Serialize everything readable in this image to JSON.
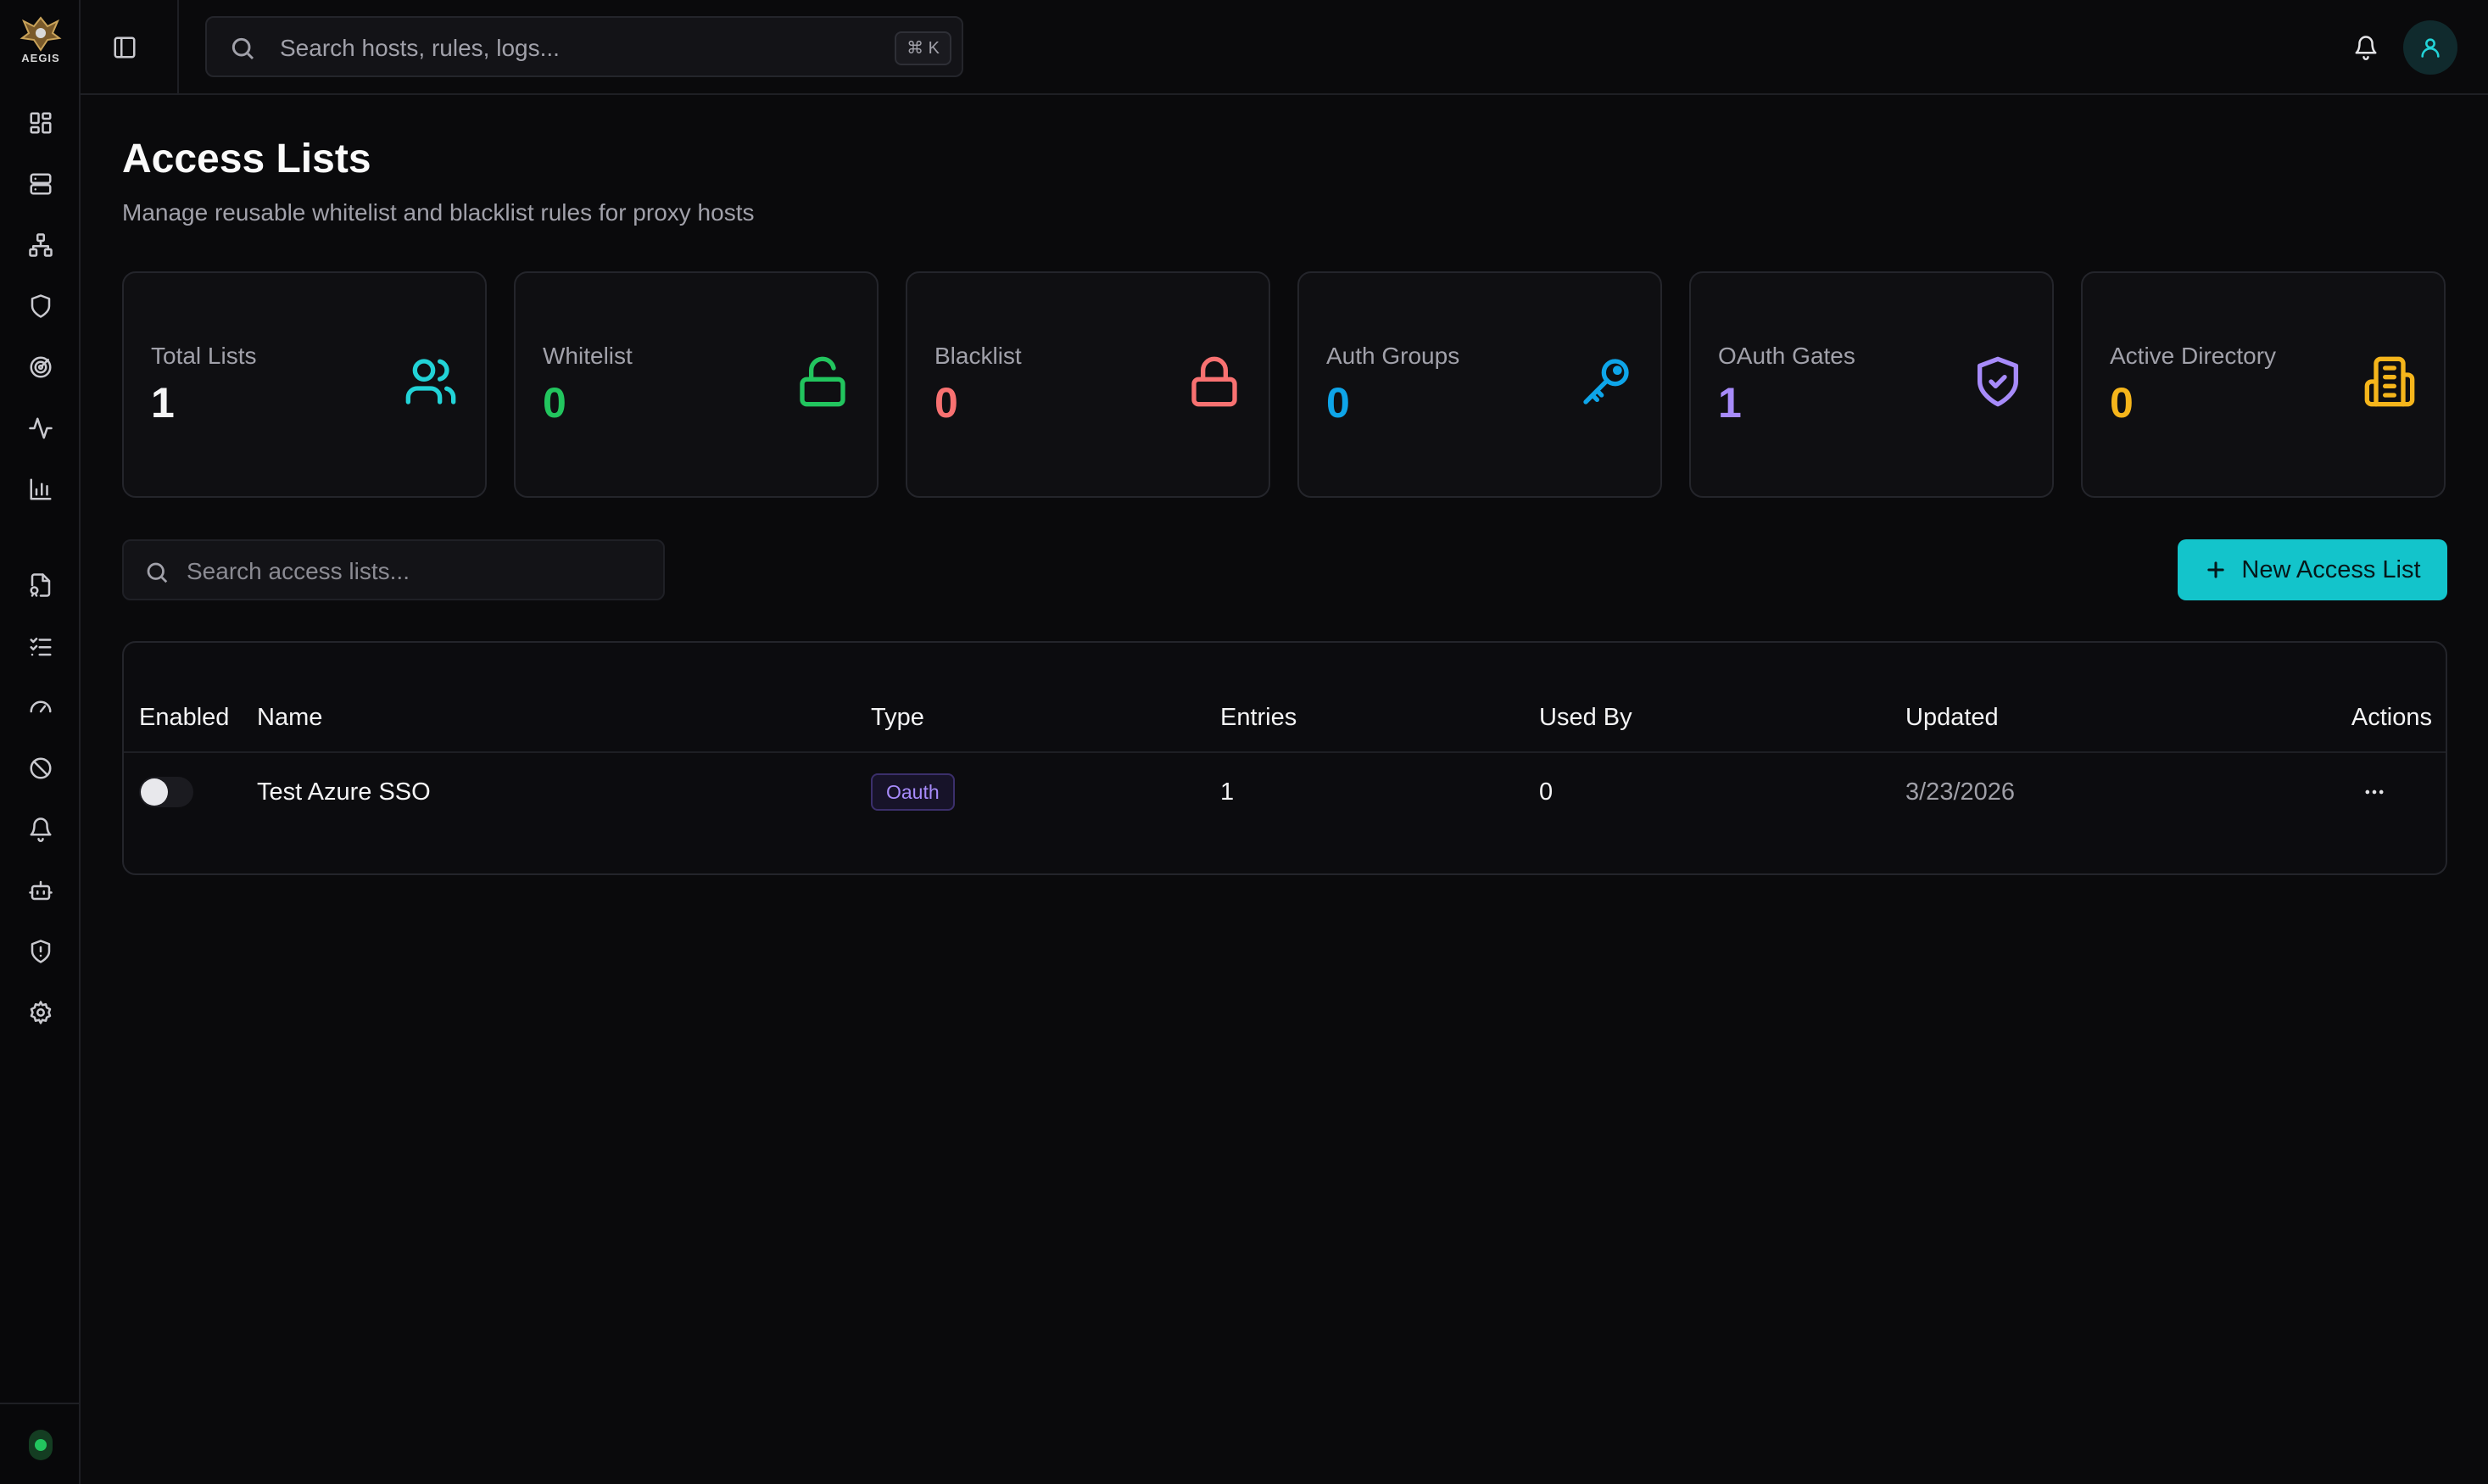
{
  "app": {
    "logo_text": "AEGIS"
  },
  "header": {
    "search_placeholder": "Search hosts, rules, logs...",
    "search_shortcut": "⌘ K"
  },
  "sidebar": {
    "icons": [
      "dashboard-icon",
      "server-icon",
      "network-icon",
      "shield-icon",
      "target-icon",
      "activity-icon",
      "bar-chart-icon",
      "file-cert-icon",
      "list-checks-icon",
      "gauge-icon",
      "ban-icon",
      "bell-icon",
      "bot-icon",
      "shield-alert-icon",
      "settings-icon"
    ],
    "status_color": "#22c55e"
  },
  "page": {
    "title": "Access Lists",
    "subtitle": "Manage reusable whitelist and blacklist rules for proxy hosts"
  },
  "stats": [
    {
      "label": "Total Lists",
      "value": "1",
      "color": "#f4f4f5",
      "icon_color": "#22d3d7",
      "icon": "users-icon"
    },
    {
      "label": "Whitelist",
      "value": "0",
      "color": "#22c55e",
      "icon_color": "#22c55e",
      "icon": "lock-open-icon"
    },
    {
      "label": "Blacklist",
      "value": "0",
      "color": "#f87171",
      "icon_color": "#f87171",
      "icon": "lock-icon"
    },
    {
      "label": "Auth Groups",
      "value": "0",
      "color": "#0ea5e9",
      "icon_color": "#0ea5e9",
      "icon": "key-icon"
    },
    {
      "label": "OAuth Gates",
      "value": "1",
      "color": "#a78bfa",
      "icon_color": "#a78bfa",
      "icon": "shield-check-icon"
    },
    {
      "label": "Active Directory",
      "value": "0",
      "color": "#f5b51b",
      "icon_color": "#f5b51b",
      "icon": "building-icon"
    }
  ],
  "list_search": {
    "placeholder": "Search access lists..."
  },
  "new_button": {
    "label": "New Access List"
  },
  "table": {
    "columns": [
      "Enabled",
      "Name",
      "Type",
      "Entries",
      "Used By",
      "Updated",
      "Actions"
    ],
    "rows": [
      {
        "enabled": false,
        "name": "Test Azure SSO",
        "type": "Oauth",
        "entries": "1",
        "used_by": "0",
        "updated": "3/23/2026"
      }
    ]
  },
  "colors": {
    "accent": "#13c4cb",
    "background": "#0a0a0c"
  }
}
